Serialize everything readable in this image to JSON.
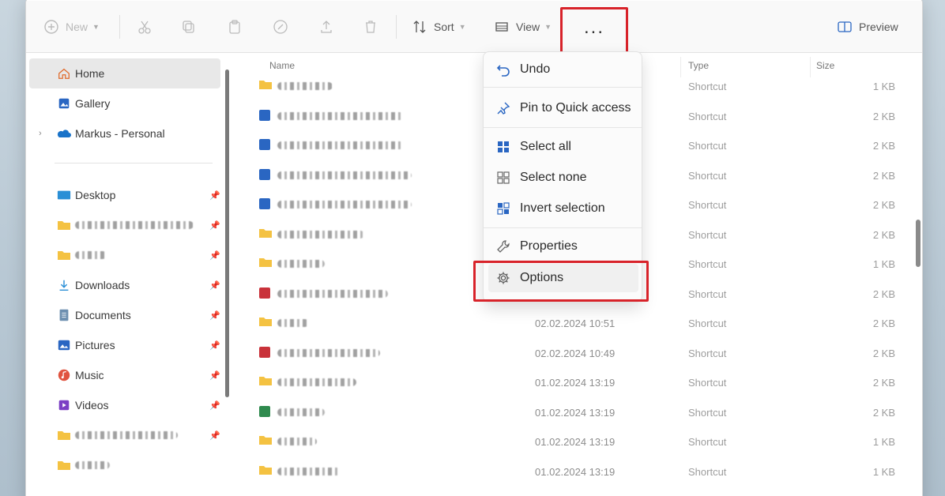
{
  "toolbar": {
    "new_label": "New",
    "sort_label": "Sort",
    "view_label": "View",
    "more_label": "...",
    "preview_label": "Preview"
  },
  "sidebar": {
    "items": [
      {
        "label": "Home",
        "icon": "home-icon"
      },
      {
        "label": "Gallery",
        "icon": "gallery-icon"
      },
      {
        "label": "Markus - Personal",
        "icon": "onedrive-cloud-icon"
      },
      {
        "label": "Desktop",
        "icon": "desktop-icon"
      },
      {
        "label": "Downloads",
        "icon": "downloads-icon"
      },
      {
        "label": "Documents",
        "icon": "documents-icon"
      },
      {
        "label": "Pictures",
        "icon": "pictures-icon"
      },
      {
        "label": "Music",
        "icon": "music-icon"
      },
      {
        "label": "Videos",
        "icon": "videos-icon"
      }
    ]
  },
  "columns": {
    "name": "Name",
    "type": "Type",
    "size": "Size"
  },
  "rows": [
    {
      "date": "",
      "type": "Shortcut",
      "size": "1 KB",
      "frag": "7"
    },
    {
      "date": "",
      "type": "Shortcut",
      "size": "2 KB",
      "frag": "7"
    },
    {
      "date": "",
      "type": "Shortcut",
      "size": "2 KB",
      "frag": "7"
    },
    {
      "date": "",
      "type": "Shortcut",
      "size": "2 KB",
      "frag": "7"
    },
    {
      "date": "",
      "type": "Shortcut",
      "size": "2 KB",
      "frag": "7"
    },
    {
      "date": "",
      "type": "Shortcut",
      "size": "2 KB",
      "frag": "8"
    },
    {
      "date": "",
      "type": "Shortcut",
      "size": "1 KB",
      "frag": ""
    },
    {
      "date": "",
      "type": "Shortcut",
      "size": "2 KB",
      "frag": ""
    },
    {
      "date": "02.02.2024 10:51",
      "type": "Shortcut",
      "size": "2 KB",
      "frag": ""
    },
    {
      "date": "02.02.2024 10:49",
      "type": "Shortcut",
      "size": "2 KB",
      "frag": ""
    },
    {
      "date": "01.02.2024 13:19",
      "type": "Shortcut",
      "size": "2 KB",
      "frag": ""
    },
    {
      "date": "01.02.2024 13:19",
      "type": "Shortcut",
      "size": "2 KB",
      "frag": ""
    },
    {
      "date": "01.02.2024 13:19",
      "type": "Shortcut",
      "size": "1 KB",
      "frag": ""
    },
    {
      "date": "01.02.2024 13:19",
      "type": "Shortcut",
      "size": "1 KB",
      "frag": ""
    }
  ],
  "menu": {
    "items": [
      {
        "label": "Undo",
        "icon": "undo-icon"
      },
      {
        "label": "Pin to Quick access",
        "icon": "pin-icon"
      },
      {
        "label": "Select all",
        "icon": "select-all-icon"
      },
      {
        "label": "Select none",
        "icon": "select-none-icon"
      },
      {
        "label": "Invert selection",
        "icon": "invert-selection-icon"
      },
      {
        "label": "Properties",
        "icon": "wrench-icon"
      },
      {
        "label": "Options",
        "icon": "gear-icon"
      }
    ]
  },
  "colors": {
    "highlight": "#d8232a",
    "folder": "#f4c242",
    "accent": "#2a66c2"
  }
}
